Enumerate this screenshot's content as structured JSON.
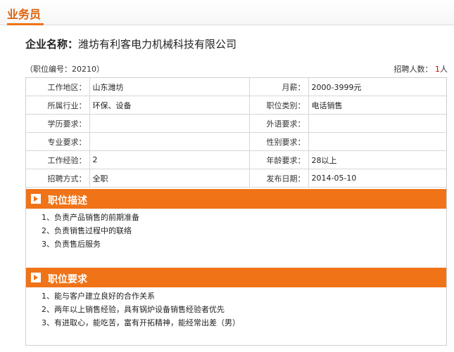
{
  "header": {
    "title": "业务员"
  },
  "company": {
    "label": "企业名称：",
    "name": "潍坊有利客电力机械科技有限公司"
  },
  "meta": {
    "job_code": "（职位编号：20210）",
    "headcount_label": "招聘人数：",
    "headcount_value": "1",
    "headcount_unit": "人"
  },
  "details": [
    {
      "label1": "工作地区：",
      "value1": "山东潍坊",
      "label2": "月薪：",
      "value2": "2000-3999元"
    },
    {
      "label1": "所属行业：",
      "value1": "环保、设备",
      "label2": "职位类别：",
      "value2": "电话销售"
    },
    {
      "label1": "学历要求：",
      "value1": "",
      "label2": "外语要求：",
      "value2": ""
    },
    {
      "label1": "专业要求：",
      "value1": "",
      "label2": "性别要求：",
      "value2": ""
    },
    {
      "label1": "工作经验：",
      "value1": "2",
      "label2": "年龄要求：",
      "value2": "28以上"
    },
    {
      "label1": "招聘方式：",
      "value1": "全职",
      "label2": "发布日期：",
      "value2": "2014-05-10"
    }
  ],
  "description": {
    "title": "职位描述",
    "items": [
      "1、负责产品销售的前期准备",
      "2、负责销售过程中的联络",
      "3、负责售后服务"
    ]
  },
  "requirements": {
    "title": "职位要求",
    "items": [
      "1、能与客户建立良好的合作关系",
      "2、两年以上销售经验，具有锅炉设备销售经验者优先",
      "3、有进取心，能吃苦，富有开拓精神，能经常出差（男）"
    ]
  },
  "colors": {
    "accent": "#f07318",
    "title": "#e0620b",
    "count": "#d10000"
  }
}
